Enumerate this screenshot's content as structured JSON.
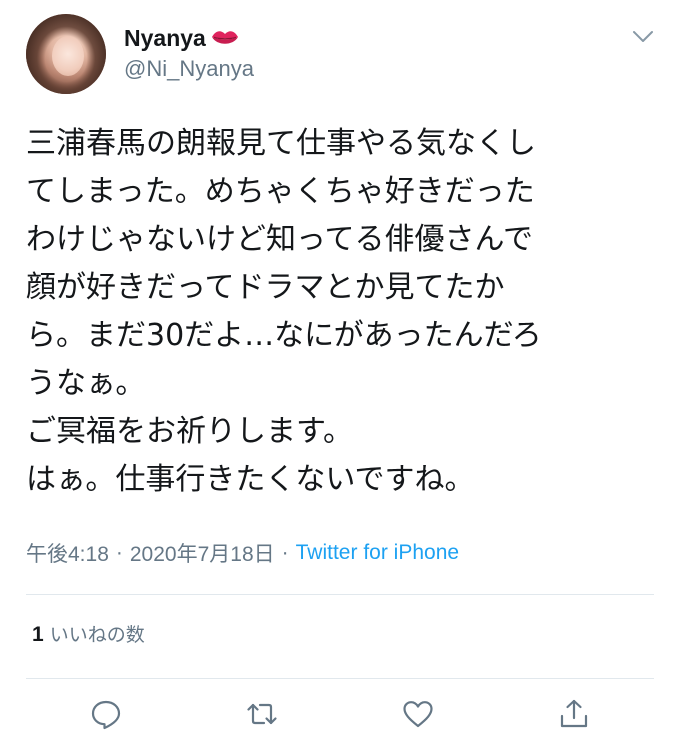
{
  "user": {
    "display_name": "Nyanya",
    "handle": "@Ni_Nyanya"
  },
  "tweet": {
    "lines": [
      "三浦春馬の朗報見て仕事やる気なくし",
      "てしまった。めちゃくちゃ好きだった",
      "わけじゃないけど知ってる俳優さんで",
      "顔が好きだってドラマとか見てたか",
      "ら。まだ30だよ…なにがあったんだろ",
      "うなぁ。",
      "ご冥福をお祈りします。",
      "はぁ。仕事行きたくないですね。"
    ],
    "time": "午後4:18",
    "date": "2020年7月18日",
    "separator": "·",
    "source": "Twitter for iPhone"
  },
  "stats": {
    "likes_count": "1",
    "likes_label": "いいねの数"
  },
  "icons": {
    "emoji": "lips-icon",
    "menu": "chevron-down-icon",
    "reply": "reply-icon",
    "retweet": "retweet-icon",
    "like": "heart-icon",
    "share": "share-icon"
  },
  "colors": {
    "text": "#14171a",
    "secondary": "#657786",
    "link": "#1da1f2",
    "divider": "#e1e8ed",
    "lips": "#e0245e"
  }
}
